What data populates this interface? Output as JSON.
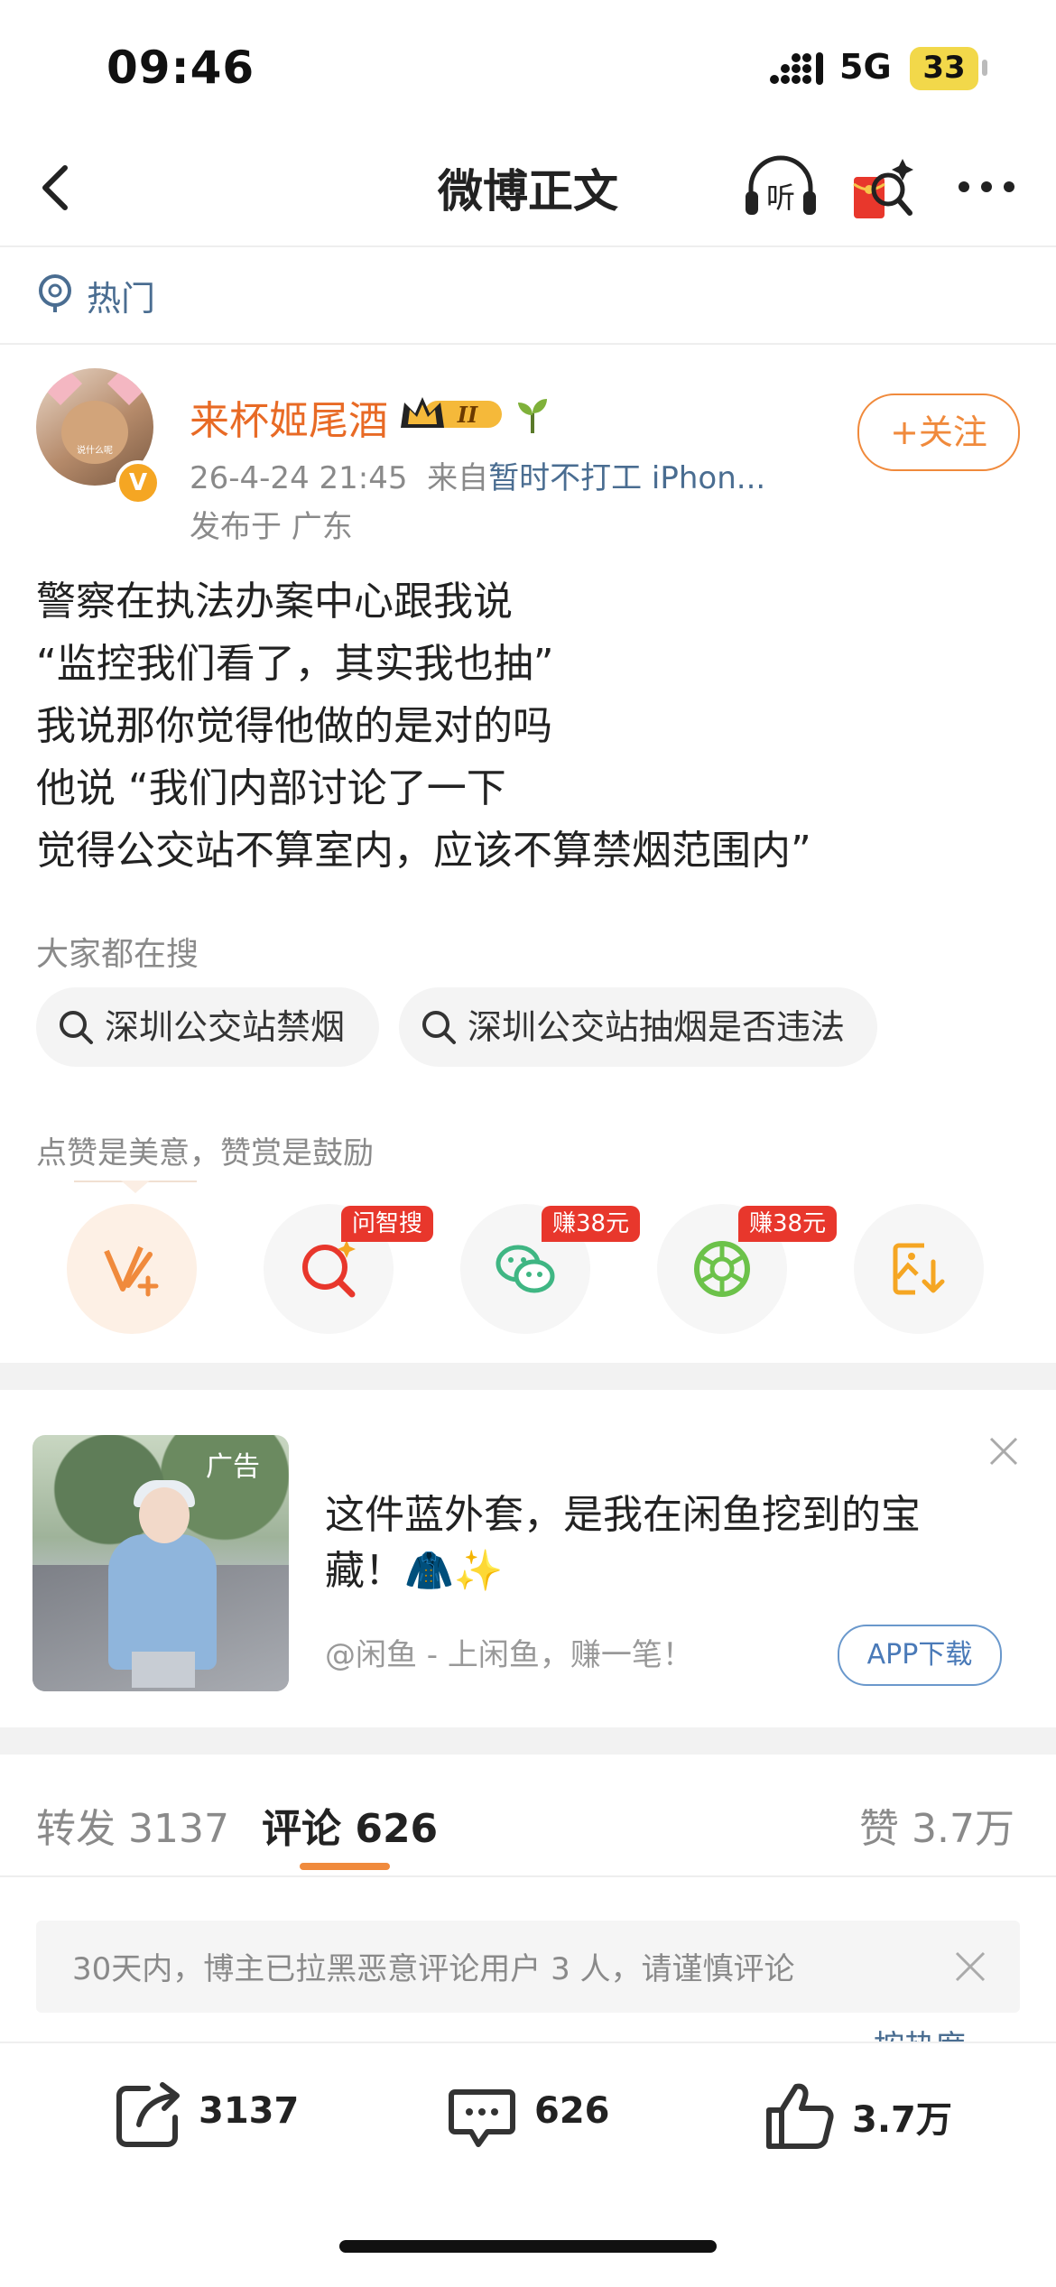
{
  "status_bar": {
    "time": "09:46",
    "network": "5G",
    "battery": "33"
  },
  "nav": {
    "title": "微博正文",
    "listen_icon": "listen-icon",
    "redpack_icon": "red-packet-icon",
    "more_icon": "more-icon"
  },
  "hot": {
    "label": "热门"
  },
  "author": {
    "name": "来杯姬尾酒",
    "avatar_caption": "说什么呢",
    "verified_badge": "V",
    "crown_rank": "II",
    "follow_label": "+关注",
    "time": "26-4-24 21:45",
    "source_prefix": "来自",
    "source": "暂时不打工 iPhon...",
    "location": "发布于 广东"
  },
  "post": {
    "lines": [
      "警察在执法办案中心跟我说",
      "“监控我们看了，其实我也抽”",
      "我说那你觉得他做的是对的吗",
      "他说 “我们内部讨论了一下",
      "觉得公交站不算室内，应该不算禁烟范围内”"
    ]
  },
  "search": {
    "title": "大家都在搜",
    "chips": [
      "深圳公交站禁烟",
      "深圳公交站抽烟是否违法"
    ]
  },
  "actions": {
    "note": "点赞是美意，赞赏是鼓励",
    "items": [
      {
        "icon": "reward-v-icon",
        "tag": ""
      },
      {
        "icon": "smart-search-icon",
        "tag": "问智搜"
      },
      {
        "icon": "wechat-icon",
        "tag": "赚38元"
      },
      {
        "icon": "moments-icon",
        "tag": "赚38元"
      },
      {
        "icon": "save-image-icon",
        "tag": ""
      }
    ]
  },
  "ad": {
    "badge": "广告",
    "title": "这件蓝外套，是我在闲鱼挖到的宝藏！🧥✨",
    "subtitle": "@闲鱼 - 上闲鱼，赚一笔！",
    "button": "APP下载"
  },
  "tabs": {
    "repost_label": "转发",
    "repost_count": "3137",
    "comment_label": "评论",
    "comment_count": "626",
    "like_label": "赞",
    "like_count": "3.7万"
  },
  "notice": {
    "text": "30天内，博主已拉黑恶意评论用户 3 人，请谨慎评论",
    "sort_peek": "按热度"
  },
  "bottom_bar": {
    "share_count": "3137",
    "comment_count": "626",
    "like_count": "3.7万"
  },
  "colors": {
    "accent": "#f08a3c",
    "link": "#4a6d91",
    "tag_red": "#e8372c",
    "username": "#e86a25"
  }
}
